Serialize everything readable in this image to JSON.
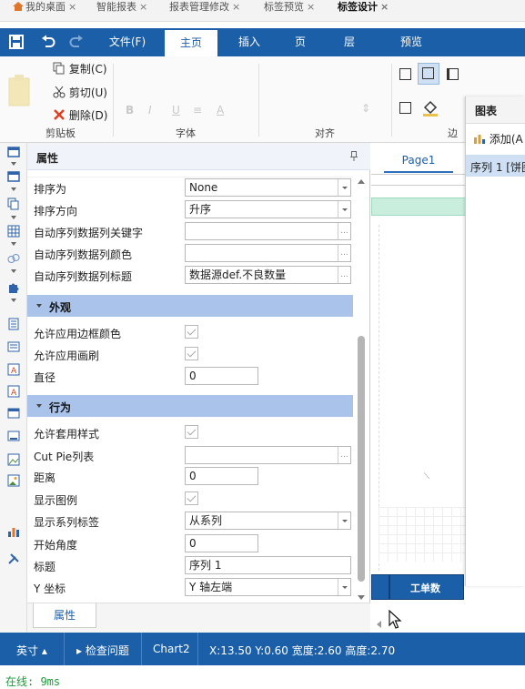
{
  "browser_tabs": [
    {
      "label": "我的桌面",
      "close": "×"
    },
    {
      "label": "智能报表",
      "close": "×"
    },
    {
      "label": "报表管理修改",
      "close": "×"
    },
    {
      "label": "标签预览",
      "close": "×"
    },
    {
      "label": "标签设计",
      "close": "×"
    }
  ],
  "ribbon_tabs": [
    "文件(F)",
    "主页",
    "插入",
    "页",
    "层",
    "预览"
  ],
  "clipboard": {
    "copy": "复制(C)",
    "cut": "剪切(U)",
    "delete": "删除(D)",
    "group": "剪贴板"
  },
  "font_group": "字体",
  "align_group": "对齐",
  "border_group_partial": "边",
  "properties": {
    "title": "属性",
    "rows_top": [
      {
        "label": "排序为",
        "value": "None",
        "type": "dropdown"
      },
      {
        "label": "排序方向",
        "value": "升序",
        "type": "dropdown"
      },
      {
        "label": "自动序列数据列关键字",
        "value": "",
        "type": "ellipsis"
      },
      {
        "label": "自动序列数据列颜色",
        "value": "",
        "type": "ellipsis"
      },
      {
        "label": "自动序列数据列标题",
        "value": "数据源def.不良数量",
        "type": "ellipsis"
      }
    ],
    "section_appearance": "外观",
    "rows_appearance": [
      {
        "label": "允许应用边框颜色",
        "type": "checkbox"
      },
      {
        "label": "允许应用画刷",
        "type": "checkbox"
      },
      {
        "label": "直径",
        "value": "0",
        "type": "text"
      }
    ],
    "section_behavior": "行为",
    "rows_behavior": [
      {
        "label": "允许套用样式",
        "type": "checkbox"
      },
      {
        "label": "Cut Pie列表",
        "value": "",
        "type": "ellipsis"
      },
      {
        "label": "距离",
        "value": "0",
        "type": "text"
      },
      {
        "label": "显示图例",
        "type": "checkbox"
      },
      {
        "label": "显示系列标签",
        "value": "从系列",
        "type": "dropdown"
      },
      {
        "label": "开始角度",
        "value": "0",
        "type": "text"
      },
      {
        "label": "标题",
        "value": "序列 1",
        "type": "wide"
      },
      {
        "label": "Y 坐标",
        "value": "Y 轴左端",
        "type": "dropdown"
      }
    ],
    "bottom_tab": "属性"
  },
  "canvas": {
    "page_tab": "Page1",
    "cell_text": "工单数"
  },
  "chart_panel": {
    "title": "图表",
    "add": "添加(A",
    "series": "序列 1 [饼图"
  },
  "status_bar": {
    "unit": "英寸",
    "check": "检查问题",
    "component": "Chart2",
    "coords": "X:13.50 Y:0.60 宽度:2.60 高度:2.70"
  },
  "online_text": "在线: 9ms"
}
